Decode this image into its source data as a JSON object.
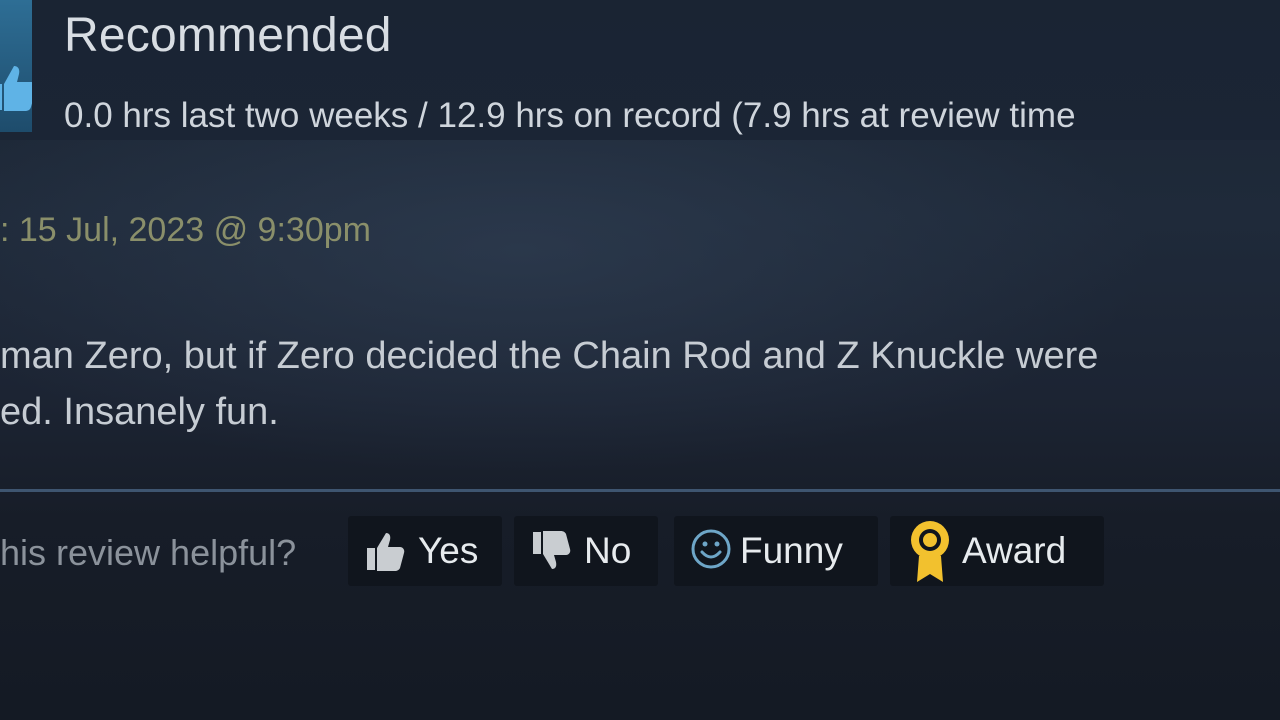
{
  "review": {
    "verdict": "Recommended",
    "hours_text": "0.0 hrs last two weeks / 12.9 hrs on record (7.9 hrs at review time",
    "posted_text": ": 15 Jul, 2023 @ 9:30pm",
    "body_lines": [
      "man Zero, but if Zero decided the Chain Rod and Z Knuckle were",
      "ed. Insanely fun."
    ]
  },
  "helpful": {
    "question": "his review helpful?",
    "buttons": {
      "yes": "Yes",
      "no": "No",
      "funny": "Funny",
      "award": "Award"
    }
  },
  "icons": {
    "verdict": "thumbs-up-icon",
    "yes": "thumbs-up-icon",
    "no": "thumbs-down-icon",
    "funny": "smiley-icon",
    "award": "award-ribbon-icon"
  },
  "colors": {
    "award_gold": "#f2c12e",
    "funny_blue": "#6ea6c8",
    "posted_text": "#8a8f6a",
    "divider": "#3e5570"
  }
}
